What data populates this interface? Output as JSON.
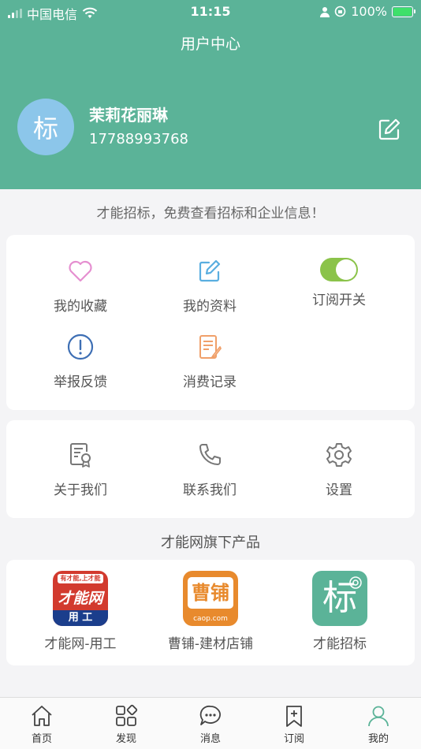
{
  "status_bar": {
    "carrier": "中国电信",
    "time": "11:15",
    "battery": "100%"
  },
  "header": {
    "title": "用户中心",
    "avatar_text": "标",
    "username": "茉莉花丽琳",
    "phone": "17788993768"
  },
  "tagline": "才能招标，免费查看招标和企业信息！",
  "menu": {
    "favorites": "我的收藏",
    "profile": "我的资料",
    "subscribe_toggle": "订阅开关",
    "report": "举报反馈",
    "consumption": "消费记录"
  },
  "info": {
    "about": "关于我们",
    "contact": "联系我们",
    "settings": "设置"
  },
  "products": {
    "section_title": "才能网旗下产品",
    "items": [
      {
        "label": "才能网-用工",
        "logo_top": "有才能,上才能网",
        "logo_main": "才能网",
        "logo_bottom": "用 工"
      },
      {
        "label": "曹铺-建材店铺",
        "logo_main": "曹铺",
        "logo_sub": "caop.com"
      },
      {
        "label": "才能招标",
        "logo_main": "标"
      }
    ]
  },
  "tabbar": {
    "home": "首页",
    "discover": "发现",
    "messages": "消息",
    "subscribe": "订阅",
    "mine": "我的"
  },
  "colors": {
    "brand": "#5bb398",
    "toggle_on": "#8bc34a",
    "favorites_icon": "#e58fd0",
    "profile_icon": "#5aaee0",
    "report_icon": "#3e6fb4",
    "consumption_icon": "#f0a06a"
  },
  "toggle_state": true
}
